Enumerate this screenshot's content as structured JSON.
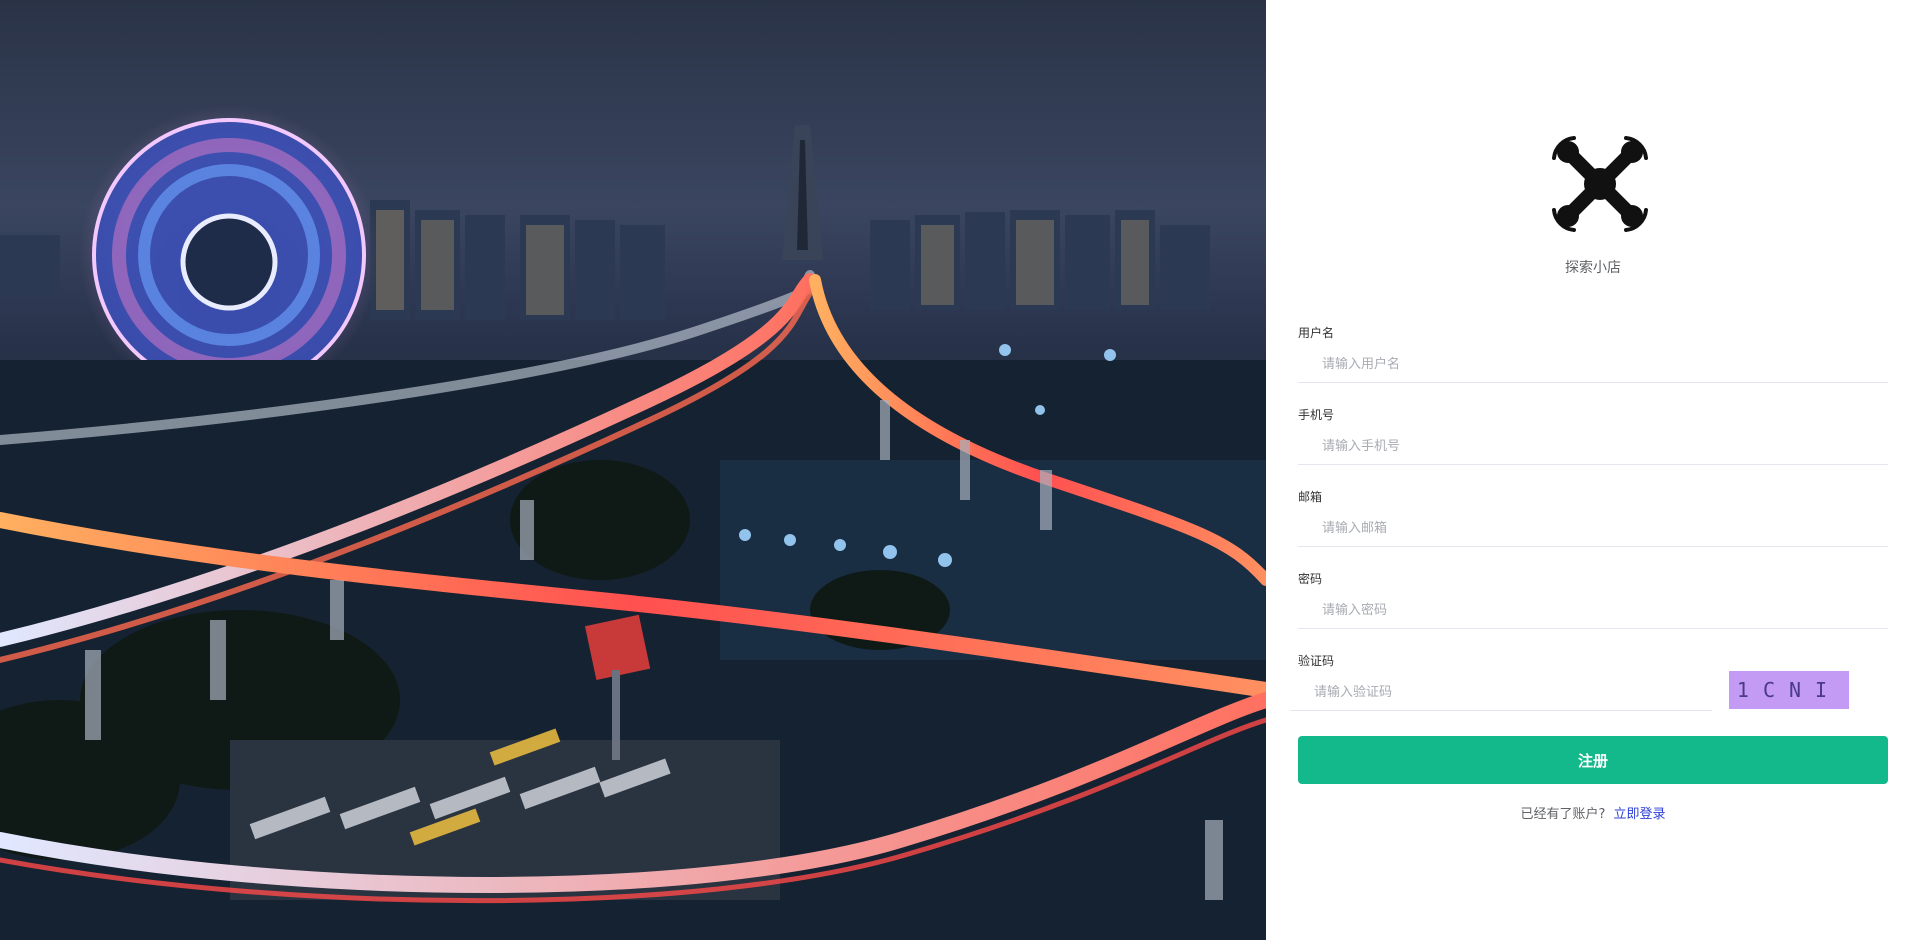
{
  "brand": {
    "name": "探索小店",
    "logo_icon": "drone-icon"
  },
  "form": {
    "username": {
      "label": "用户名",
      "placeholder": "请输入用户名",
      "value": ""
    },
    "phone": {
      "label": "手机号",
      "placeholder": "请输入手机号",
      "value": ""
    },
    "email": {
      "label": "邮箱",
      "placeholder": "请输入邮箱",
      "value": ""
    },
    "password": {
      "label": "密码",
      "placeholder": "请输入密码",
      "value": ""
    },
    "captcha": {
      "label": "验证码",
      "placeholder": "请输入验证码",
      "value": "",
      "image_text": "1CNI"
    }
  },
  "actions": {
    "register_label": "注册",
    "have_account_text": "已经有了账户?",
    "login_link_text": "立即登录"
  },
  "colors": {
    "primary": "#13b98a",
    "link": "#2d3fd8",
    "captcha_bg": "#c39af4"
  }
}
